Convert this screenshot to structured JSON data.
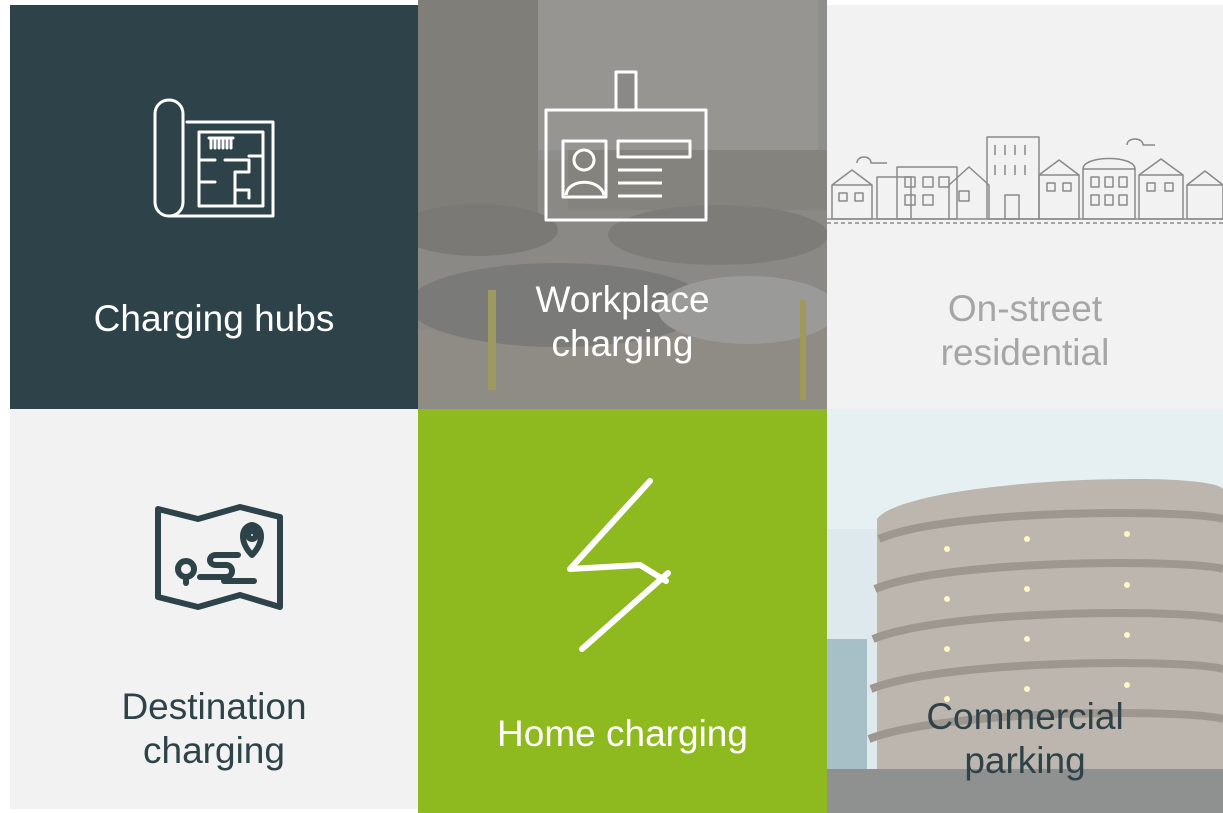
{
  "tiles": {
    "charging_hubs": {
      "label": "Charging hubs",
      "icon": "blueprint-icon"
    },
    "workplace": {
      "label": "Workplace\ncharging",
      "icon": "id-badge-icon"
    },
    "on_street": {
      "label": "On-street\nresidential",
      "icon": "houses-street-icon"
    },
    "destination": {
      "label": "Destination\ncharging",
      "icon": "map-route-icon"
    },
    "home": {
      "label": "Home charging",
      "icon": "lightning-bolt-icon"
    },
    "commercial": {
      "label": "Commercial\nparking",
      "icon": "multistorey-car-park-photo"
    }
  },
  "colors": {
    "dark_teal": "#2d4249",
    "lime_green": "#8fba1f",
    "light_grey": "#f2f2f2",
    "label_grey": "#a6a6a6",
    "dark_text": "#2d4249",
    "white": "#ffffff"
  }
}
